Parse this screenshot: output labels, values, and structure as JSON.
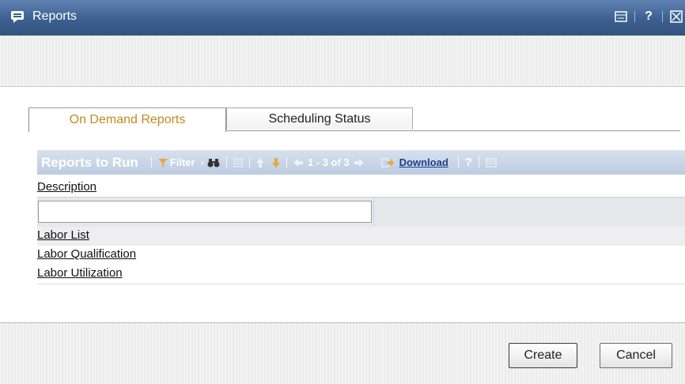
{
  "window": {
    "title": "Reports"
  },
  "tabs": [
    {
      "label": "On Demand Reports",
      "active": true
    },
    {
      "label": "Scheduling Status",
      "active": false
    }
  ],
  "grid": {
    "title": "Reports to Run",
    "filter_label": "Filter",
    "pager": "1 - 3 of 3",
    "download_label": "Download",
    "help_label": "?",
    "column_header": "Description",
    "filter_value": "",
    "rows": [
      "Labor List",
      "Labor Qualification",
      "Labor Utilization"
    ]
  },
  "buttons": {
    "create": "Create",
    "cancel": "Cancel"
  },
  "colors": {
    "titlebar": "#3d5f8f",
    "gridbar": "#c6d3e6",
    "active_tab_text": "#c08a1f"
  }
}
